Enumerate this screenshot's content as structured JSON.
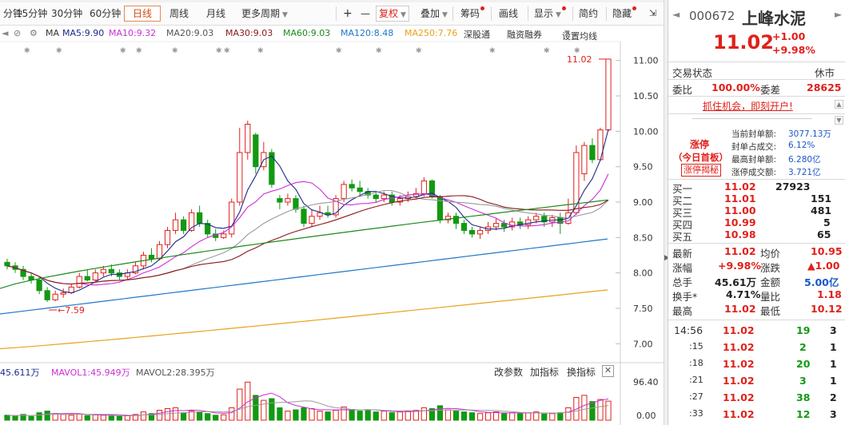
{
  "toolbar": {
    "tabs": [
      "分钟",
      "15分钟",
      "30分钟",
      "60分钟",
      "日线",
      "周线",
      "月线",
      "更多周期"
    ],
    "active_tab": "日线",
    "plus": "+",
    "minus": "—",
    "fuquan": "复权",
    "overlay": "叠加",
    "chips": "筹码",
    "drawline": "画线",
    "display": "显示",
    "brief": "简约",
    "hide": "隐藏"
  },
  "ma_row": {
    "ma": "MA",
    "ma5": "MA5:9.90",
    "ma10": "MA10:9.32",
    "ma20": "MA20:9.03",
    "ma30": "MA30:9.03",
    "ma60": "MA60:9.03",
    "ma120": "MA120:8.48",
    "ma250": "MA250:7.76",
    "deep_link": "深股通",
    "margin": "融资融券",
    "set_ma": "设置均线"
  },
  "colors": {
    "up": "#e0201b",
    "down": "#129912",
    "ma5": "#1b2b8c",
    "ma10": "#cc2fd6",
    "ma20": "#9a9a9a",
    "ma30": "#8a1818",
    "ma60": "#1c8a1c",
    "ma120": "#1f78c8",
    "ma250": "#e8a21a"
  },
  "chart_data": {
    "type": "candlestick",
    "y_ticks": [
      "11.00",
      "10.50",
      "10.00",
      "9.50",
      "9.00",
      "8.50",
      "8.00",
      "7.50",
      "7.00"
    ],
    "ylim": [
      6.8,
      11.2
    ],
    "high_label": "11.02",
    "low_label": "7.59",
    "candles": [
      [
        8.15,
        8.1,
        8.2,
        8.05
      ],
      [
        8.1,
        8.05,
        8.15,
        8.0
      ],
      [
        8.05,
        7.95,
        8.1,
        7.9
      ],
      [
        7.95,
        7.9,
        8.0,
        7.85
      ],
      [
        7.9,
        7.75,
        7.95,
        7.7
      ],
      [
        7.75,
        7.62,
        7.8,
        7.59
      ],
      [
        7.62,
        7.7,
        7.75,
        7.6
      ],
      [
        7.7,
        7.72,
        7.78,
        7.65
      ],
      [
        7.72,
        7.8,
        7.85,
        7.7
      ],
      [
        7.8,
        7.95,
        8.0,
        7.78
      ],
      [
        7.95,
        7.9,
        8.05,
        7.88
      ],
      [
        7.9,
        8.0,
        8.05,
        7.88
      ],
      [
        8.0,
        8.05,
        8.1,
        7.95
      ],
      [
        8.05,
        8.0,
        8.12,
        7.95
      ],
      [
        8.0,
        7.95,
        8.05,
        7.9
      ],
      [
        7.95,
        8.0,
        8.05,
        7.9
      ],
      [
        8.0,
        8.1,
        8.15,
        7.98
      ],
      [
        8.1,
        8.25,
        8.3,
        8.05
      ],
      [
        8.25,
        8.2,
        8.35,
        8.15
      ],
      [
        8.2,
        8.4,
        8.45,
        8.18
      ],
      [
        8.4,
        8.6,
        8.65,
        8.35
      ],
      [
        8.6,
        8.75,
        8.85,
        8.55
      ],
      [
        8.75,
        8.6,
        8.8,
        8.55
      ],
      [
        8.6,
        8.85,
        8.9,
        8.58
      ],
      [
        8.85,
        8.7,
        8.95,
        8.65
      ],
      [
        8.7,
        8.55,
        8.75,
        8.5
      ],
      [
        8.55,
        8.5,
        8.62,
        8.45
      ],
      [
        8.5,
        8.55,
        8.6,
        8.48
      ],
      [
        8.55,
        9.0,
        9.05,
        8.5
      ],
      [
        9.0,
        9.7,
        10.05,
        8.95
      ],
      [
        9.7,
        10.1,
        10.15,
        9.6
      ],
      [
        9.95,
        9.5,
        9.98,
        9.4
      ],
      [
        9.5,
        9.7,
        9.85,
        9.45
      ],
      [
        9.7,
        9.25,
        9.75,
        9.2
      ],
      [
        9.05,
        9.0,
        9.1,
        8.9
      ],
      [
        9.0,
        9.05,
        9.12,
        8.95
      ],
      [
        9.05,
        8.9,
        9.1,
        8.85
      ],
      [
        8.9,
        8.7,
        8.95,
        8.65
      ],
      [
        8.7,
        8.8,
        8.9,
        8.65
      ],
      [
        8.8,
        8.85,
        8.95,
        8.75
      ],
      [
        8.85,
        8.82,
        8.95,
        8.78
      ],
      [
        8.82,
        9.05,
        9.1,
        8.78
      ],
      [
        9.05,
        9.25,
        9.3,
        9.0
      ],
      [
        9.25,
        9.2,
        9.32,
        9.15
      ],
      [
        9.2,
        9.15,
        9.3,
        9.1
      ],
      [
        9.15,
        9.1,
        9.2,
        9.05
      ],
      [
        9.1,
        9.05,
        9.15,
        9.0
      ],
      [
        9.05,
        9.1,
        9.15,
        9.0
      ],
      [
        9.1,
        9.0,
        9.15,
        8.95
      ],
      [
        9.0,
        9.05,
        9.1,
        8.95
      ],
      [
        9.05,
        9.08,
        9.15,
        9.0
      ],
      [
        9.08,
        9.12,
        9.2,
        9.05
      ],
      [
        9.12,
        9.3,
        9.35,
        9.08
      ],
      [
        9.3,
        9.08,
        9.32,
        9.05
      ],
      [
        9.08,
        8.75,
        9.1,
        8.7
      ],
      [
        8.75,
        8.8,
        8.85,
        8.7
      ],
      [
        8.8,
        8.7,
        8.85,
        8.62
      ],
      [
        8.7,
        8.6,
        8.75,
        8.55
      ],
      [
        8.6,
        8.55,
        8.65,
        8.5
      ],
      [
        8.55,
        8.6,
        8.65,
        8.48
      ],
      [
        8.6,
        8.65,
        8.72,
        8.55
      ],
      [
        8.65,
        8.7,
        8.78,
        8.6
      ],
      [
        8.7,
        8.65,
        8.75,
        8.58
      ],
      [
        8.65,
        8.72,
        8.78,
        8.6
      ],
      [
        8.72,
        8.68,
        8.78,
        8.62
      ],
      [
        8.68,
        8.75,
        8.8,
        8.62
      ],
      [
        8.75,
        8.8,
        8.85,
        8.7
      ],
      [
        8.8,
        8.72,
        8.85,
        8.65
      ],
      [
        8.72,
        8.78,
        8.82,
        8.65
      ],
      [
        8.78,
        8.7,
        8.85,
        8.55
      ],
      [
        8.7,
        8.85,
        9.05,
        8.68
      ],
      [
        8.85,
        9.7,
        9.8,
        8.82
      ],
      [
        9.4,
        9.8,
        9.85,
        9.3
      ],
      [
        9.8,
        9.6,
        9.9,
        9.55
      ],
      [
        9.6,
        10.02,
        10.05,
        9.58
      ],
      [
        10.02,
        11.02,
        11.02,
        10.0
      ]
    ],
    "volume": {
      "label_vol": "45.611万",
      "label_mavol1": "MAVOL1:45.949万",
      "label_mavol2": "MAVOL2:28.395万",
      "modify": "改参数",
      "add": "加指标",
      "swap": "换指标",
      "y_top": "96.40",
      "y_bottom": "0.00",
      "max": 96.4,
      "values": [
        12,
        10,
        14,
        9,
        18,
        22,
        16,
        14,
        12,
        15,
        11,
        13,
        12,
        10,
        9,
        11,
        14,
        20,
        16,
        24,
        28,
        30,
        18,
        22,
        20,
        16,
        12,
        13,
        30,
        75,
        92,
        60,
        48,
        52,
        30,
        22,
        25,
        30,
        28,
        22,
        20,
        24,
        32,
        26,
        22,
        24,
        20,
        22,
        18,
        20,
        22,
        24,
        30,
        28,
        35,
        25,
        22,
        20,
        18,
        16,
        18,
        20,
        16,
        18,
        16,
        18,
        20,
        15,
        16,
        18,
        30,
        55,
        60,
        45,
        50,
        46
      ]
    }
  },
  "panel": {
    "code": "000672",
    "name": "上峰水泥",
    "price": "11.02",
    "change": "+1.00",
    "change_pct": "+9.98%",
    "status_label": "交易状态",
    "status_value": "休市",
    "weibi_label": "委比",
    "weibi_value": "100.00%",
    "weicha_label": "委差",
    "weicha_value": "28625",
    "promo": "抓住机会，即刻开户!",
    "limit_up": "涨停",
    "first_board": "（今日首板）",
    "reveal": "涨停揭秘",
    "seal_rows": [
      {
        "label": "当前封单额:",
        "value": "3077.13万"
      },
      {
        "label": "封单占成交:",
        "value": "6.12%"
      },
      {
        "label": "最高封单额:",
        "value": "6.280亿"
      },
      {
        "label": "涨停成交额:",
        "value": "3.721亿"
      }
    ],
    "bids": [
      {
        "label": "买一",
        "price": "11.02",
        "vol": "27923"
      },
      {
        "label": "买二",
        "price": "11.01",
        "vol": "151"
      },
      {
        "label": "买三",
        "price": "11.00",
        "vol": "481"
      },
      {
        "label": "买四",
        "price": "10.99",
        "vol": "5"
      },
      {
        "label": "买五",
        "price": "10.98",
        "vol": "65"
      }
    ],
    "stats": [
      {
        "l1": "最新",
        "v1": "11.02",
        "l2": "均价",
        "v2": "10.95"
      },
      {
        "l1": "涨幅",
        "v1": "+9.98%",
        "l2": "涨跌",
        "v2": "▲1.00"
      },
      {
        "l1": "总手",
        "v1": "45.61万",
        "l2": "金额",
        "v2": "5.00亿"
      },
      {
        "l1": "换手*",
        "v1": "4.71%",
        "l2": "量比",
        "v2": "1.18"
      },
      {
        "l1": "最高",
        "v1": "11.02",
        "l2": "最低",
        "v2": "10.12"
      }
    ],
    "ticks": [
      {
        "time": "14:56",
        "price": "11.02",
        "vol": "19",
        "n": "3"
      },
      {
        "time": ":15",
        "price": "11.02",
        "vol": "2",
        "n": "1"
      },
      {
        "time": ":18",
        "price": "11.02",
        "vol": "20",
        "n": "1"
      },
      {
        "time": ":21",
        "price": "11.02",
        "vol": "3",
        "n": "1"
      },
      {
        "time": ":27",
        "price": "11.02",
        "vol": "38",
        "n": "2"
      },
      {
        "time": ":33",
        "price": "11.02",
        "vol": "12",
        "n": "3"
      }
    ]
  }
}
